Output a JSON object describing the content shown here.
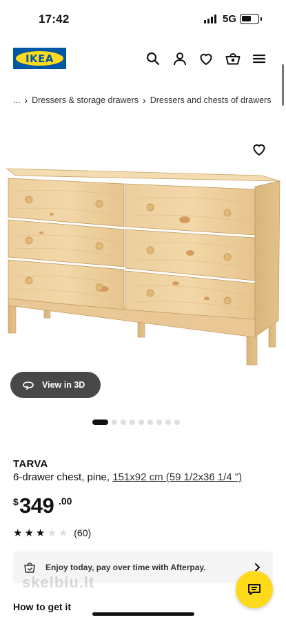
{
  "status_bar": {
    "time": "17:42",
    "network": "5G",
    "battery_level": 0.6
  },
  "header": {
    "logo_text": "IKEA",
    "icons": [
      "search-icon",
      "account-icon",
      "heart-icon",
      "basket-icon",
      "menu-icon"
    ]
  },
  "breadcrumb": {
    "items": [
      "...",
      "Dressers & storage drawers",
      "Dressers and chests of drawers"
    ]
  },
  "gallery": {
    "view_3d_label": "View in 3D",
    "image_count": 10,
    "active_index": 0
  },
  "product": {
    "name": "TARVA",
    "description": "6-drawer chest, pine,",
    "dimensions": "151x92 cm (59 1/2x36 1/4 \")",
    "price": {
      "currency": "$",
      "integer": "349",
      "decimal": ".00"
    },
    "rating": {
      "stars": 3,
      "max": 5,
      "count": "(60)"
    }
  },
  "afterpay": {
    "text": "Enjoy today, pay over time with Afterpay."
  },
  "watermark": "skelbiu.lt",
  "section": {
    "how_to_get": "How to get it"
  },
  "colors": {
    "ikea_blue": "#0058a3",
    "ikea_yellow": "#ffda1a",
    "pill_dark": "#484848"
  }
}
